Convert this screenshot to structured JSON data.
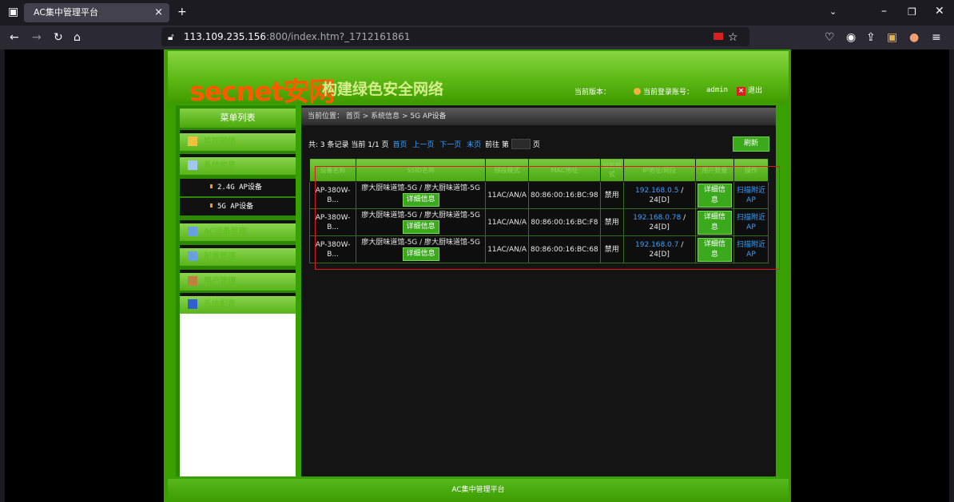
{
  "browser": {
    "tab_title": "AC集中管理平台",
    "tab_close": "×",
    "new_tab": "+",
    "url_host": "113.109.235.156",
    "url_rest": ":800/index.htm?_1712161861"
  },
  "header": {
    "logo": "secnet安网",
    "slogan": "构建绿色安全网络",
    "version_label": "当前版本：",
    "account_label": "当前登录账号：",
    "username": "admin",
    "logout": "退出"
  },
  "sidebar": {
    "title": "菜单列表",
    "items": [
      {
        "label": "监控网络"
      },
      {
        "label": "系统信息"
      },
      {
        "label": "AC设备管理"
      },
      {
        "label": "配置管理"
      },
      {
        "label": "用户管理"
      },
      {
        "label": "系统配置"
      }
    ],
    "subitems": [
      {
        "label": "2.4G AP设备"
      },
      {
        "label": "5G AP设备"
      }
    ]
  },
  "breadcrumb": {
    "text": "当前位置： 首页 > 系统信息 > 5G AP设备"
  },
  "pager": {
    "summary": "共: 3 条记录 当前 1/1 页",
    "first": "首页",
    "prev": "上一页",
    "next": "下一页",
    "last": "末页",
    "goto": "前往 第",
    "page_unit": "页",
    "refresh": "刷新"
  },
  "table": {
    "headers": [
      "设备名称",
      "SSID名称",
      "频段模式",
      "MAC地址",
      "加密模式",
      "IP地址/网段",
      "用户数量",
      "操作"
    ],
    "rows": [
      {
        "name": "AP-380W-B...",
        "ssid": "廖大厨味道馆-5G / 廖大厨味道馆-5G",
        "detail": "详细信息",
        "mode": "11AC/AN/A",
        "mac": "80:86:00:16:BC:98",
        "enc": "禁用",
        "ip": "192.168.0.5",
        "ip_suffix": " / 24[D]",
        "detail2": "详细信息",
        "scan": "扫描附近AP"
      },
      {
        "name": "AP-380W-B...",
        "ssid": "廖大厨味道馆-5G / 廖大厨味道馆-5G",
        "detail": "详细信息",
        "mode": "11AC/AN/A",
        "mac": "80:86:00:16:BC:F8",
        "enc": "禁用",
        "ip": "192.168.0.78",
        "ip_suffix": " / 24[D]",
        "detail2": "详细信息",
        "scan": "扫描附近AP"
      },
      {
        "name": "AP-380W-B...",
        "ssid": "廖大厨味道馆-5G / 廖大厨味道馆-5G",
        "detail": "详细信息",
        "mode": "11AC/AN/A",
        "mac": "80:86:00:16:BC:68",
        "enc": "禁用",
        "ip": "192.168.0.7",
        "ip_suffix": " / 24[D]",
        "detail2": "详细信息",
        "scan": "扫描附近AP"
      }
    ]
  },
  "footer": {
    "text": "AC集中管理平台"
  },
  "colors": {
    "brand_green": "#4aa812",
    "brand_orange": "#ff5a00",
    "link_blue": "#3aa0ff",
    "highlight_red": "#d81a1a"
  }
}
